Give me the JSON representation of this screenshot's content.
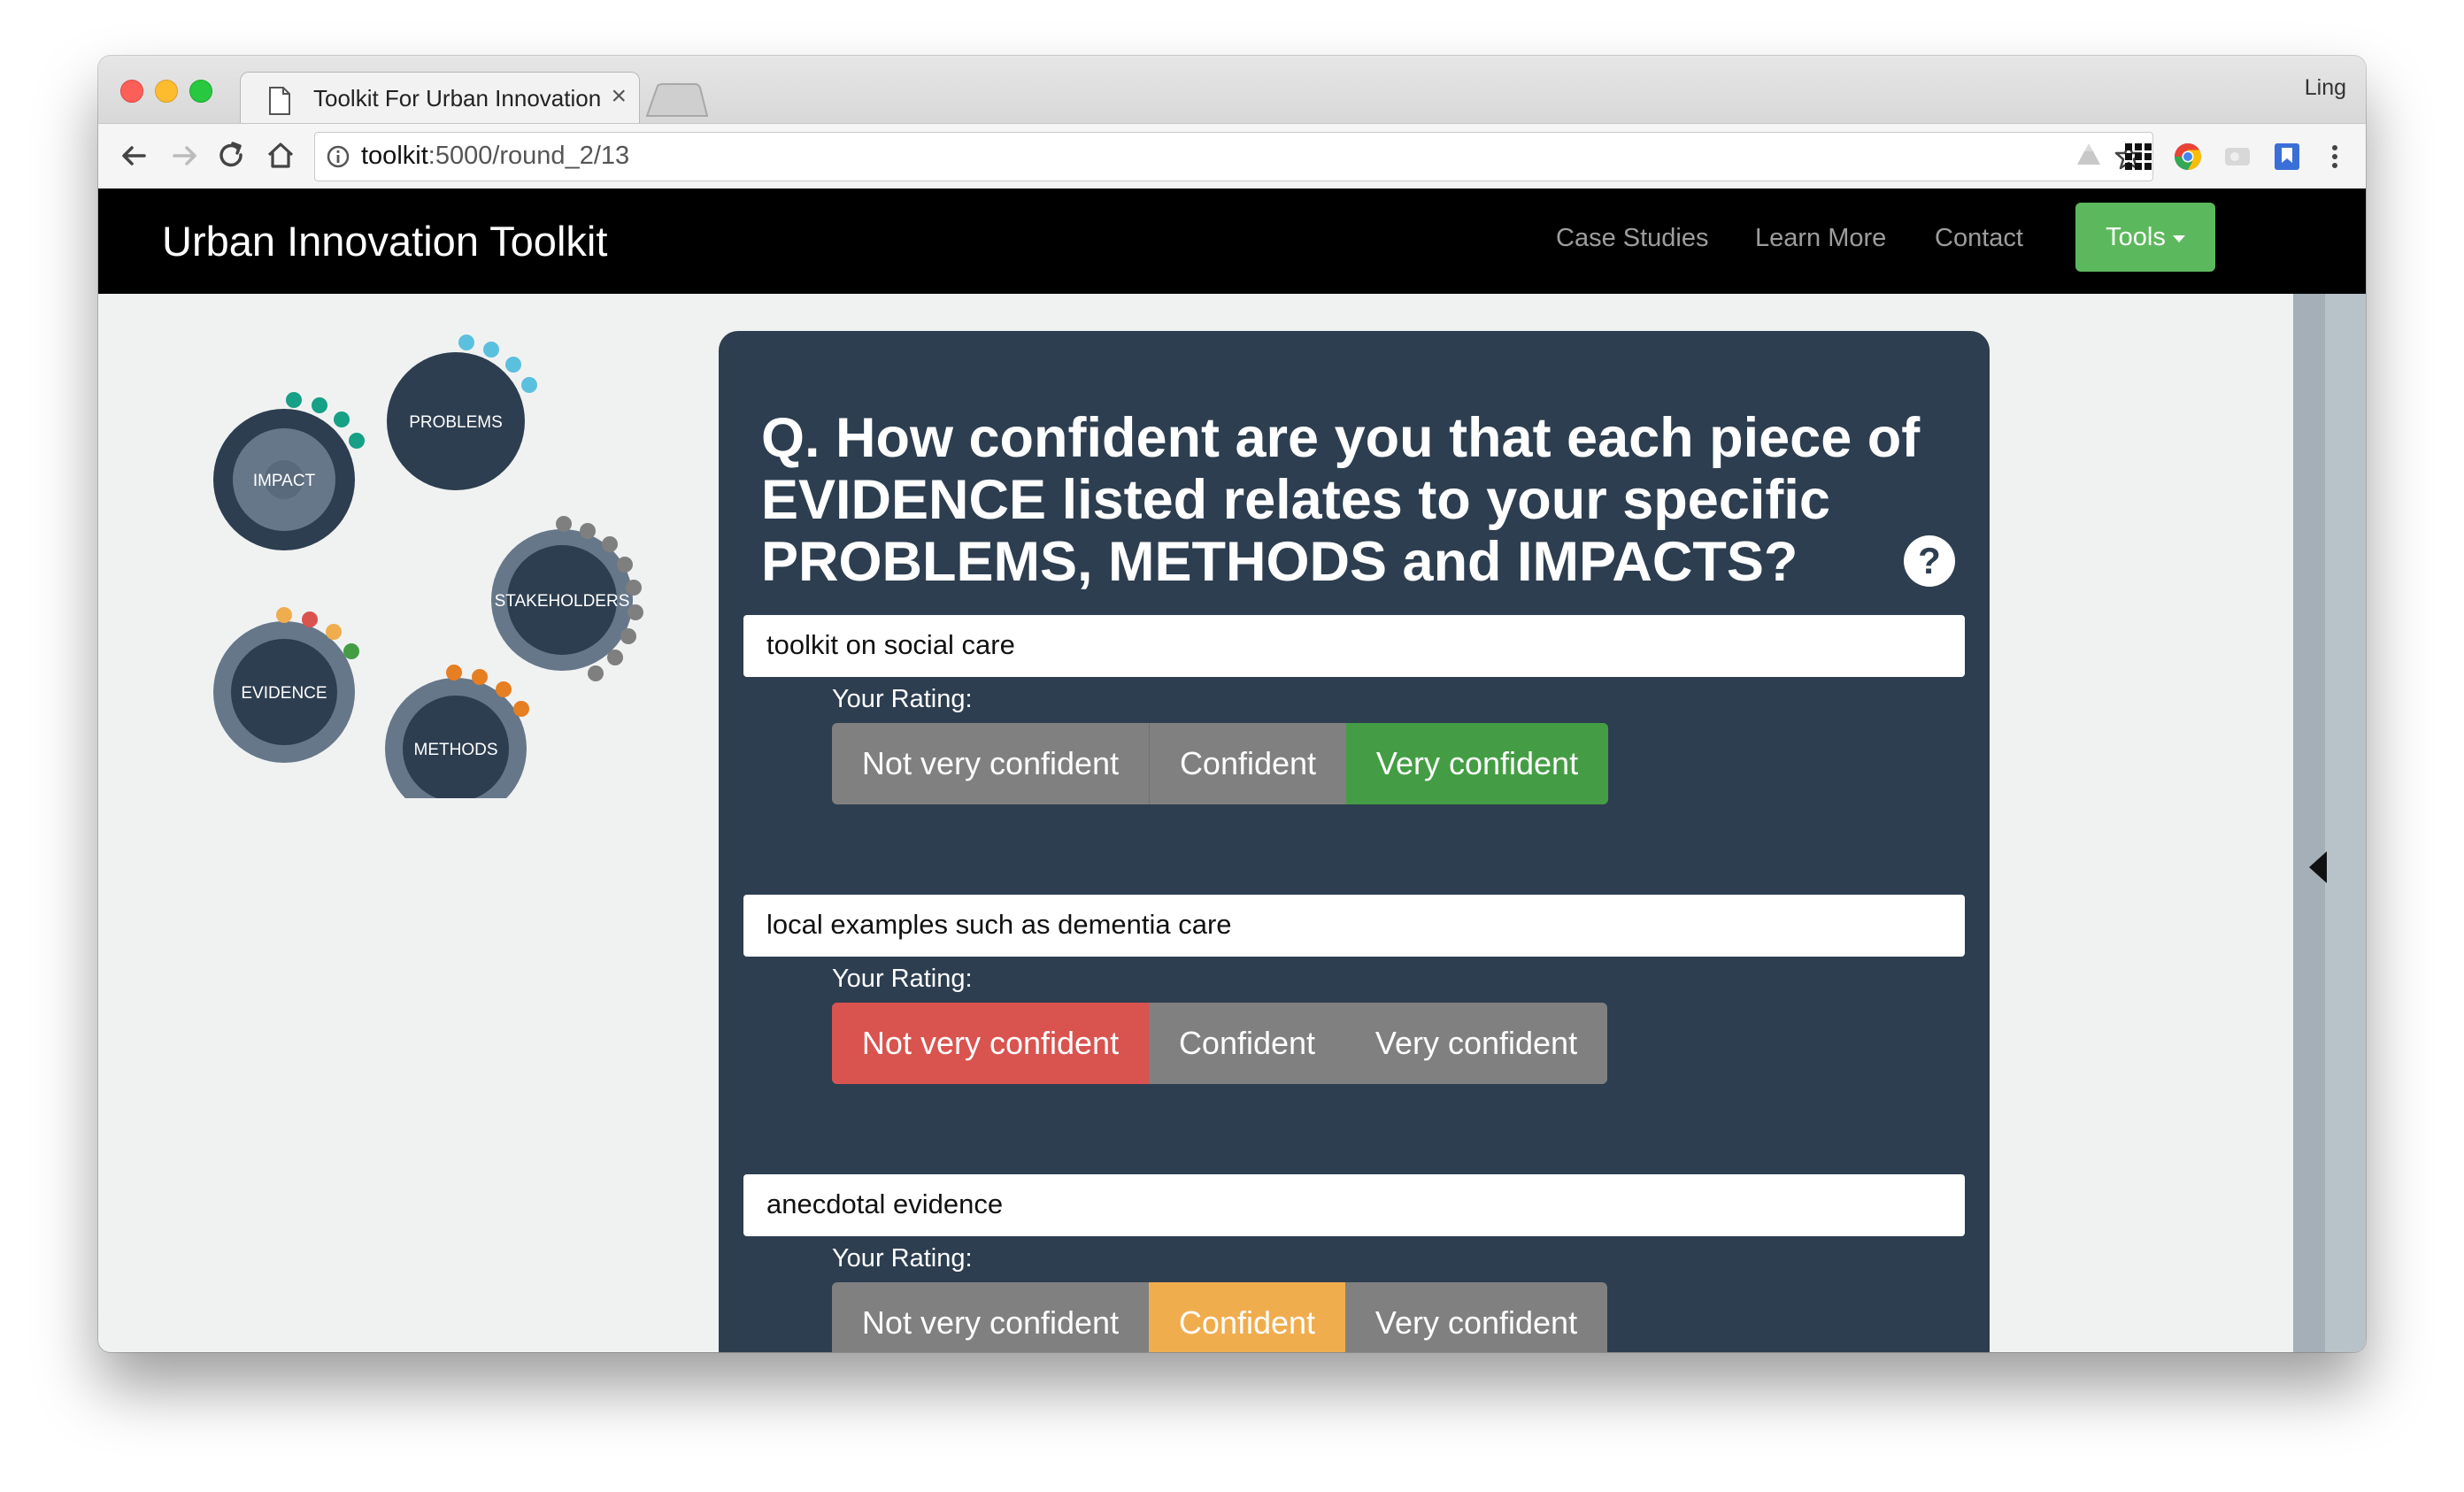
{
  "browser": {
    "tab_title": "Toolkit For Urban Innovation",
    "tab_close": "×",
    "profile": "Ling",
    "url_host": "toolkit",
    "url_rest": ":5000/round_2/13"
  },
  "navbar": {
    "brand": "Urban Innovation Toolkit",
    "links": [
      "Case Studies",
      "Learn More",
      "Contact"
    ],
    "tools_label": "Tools"
  },
  "diagram": {
    "nodes": [
      "PROBLEMS",
      "IMPACT",
      "STAKEHOLDERS",
      "EVIDENCE",
      "METHODS"
    ],
    "colors": {
      "node_dark": "#2d3e50",
      "ring": "#67778a",
      "problems_dots": "#5bc0de",
      "impact_dots": "#16a085",
      "stakeholders_dots": "#7f7f7f",
      "evidence_dots": [
        "#f0ad4e",
        "#d9534f",
        "#f0ad4e",
        "#449d44"
      ],
      "methods_dots": "#e67e22"
    }
  },
  "question": "Q. How confident are you that each piece of EVIDENCE listed relates to your specific PROBLEMS, METHODS and IMPACTS?",
  "rating_label": "Your Rating:",
  "rating_options": [
    "Not very confident",
    "Confident",
    "Very confident"
  ],
  "evidence_items": [
    {
      "text": "toolkit on social care",
      "selected": "Very confident"
    },
    {
      "text": "local examples such as dementia care",
      "selected": "Not very confident"
    },
    {
      "text": "anecdotal evidence",
      "selected": "Confident"
    }
  ],
  "colors": {
    "navbar_bg": "#000000",
    "tools_green": "#5cb85c",
    "panel_bg": "#2d3e50",
    "rating_default": "#808080",
    "rating_not": "#d9534f",
    "rating_conf": "#f0ad4e",
    "rating_very": "#449d44"
  }
}
